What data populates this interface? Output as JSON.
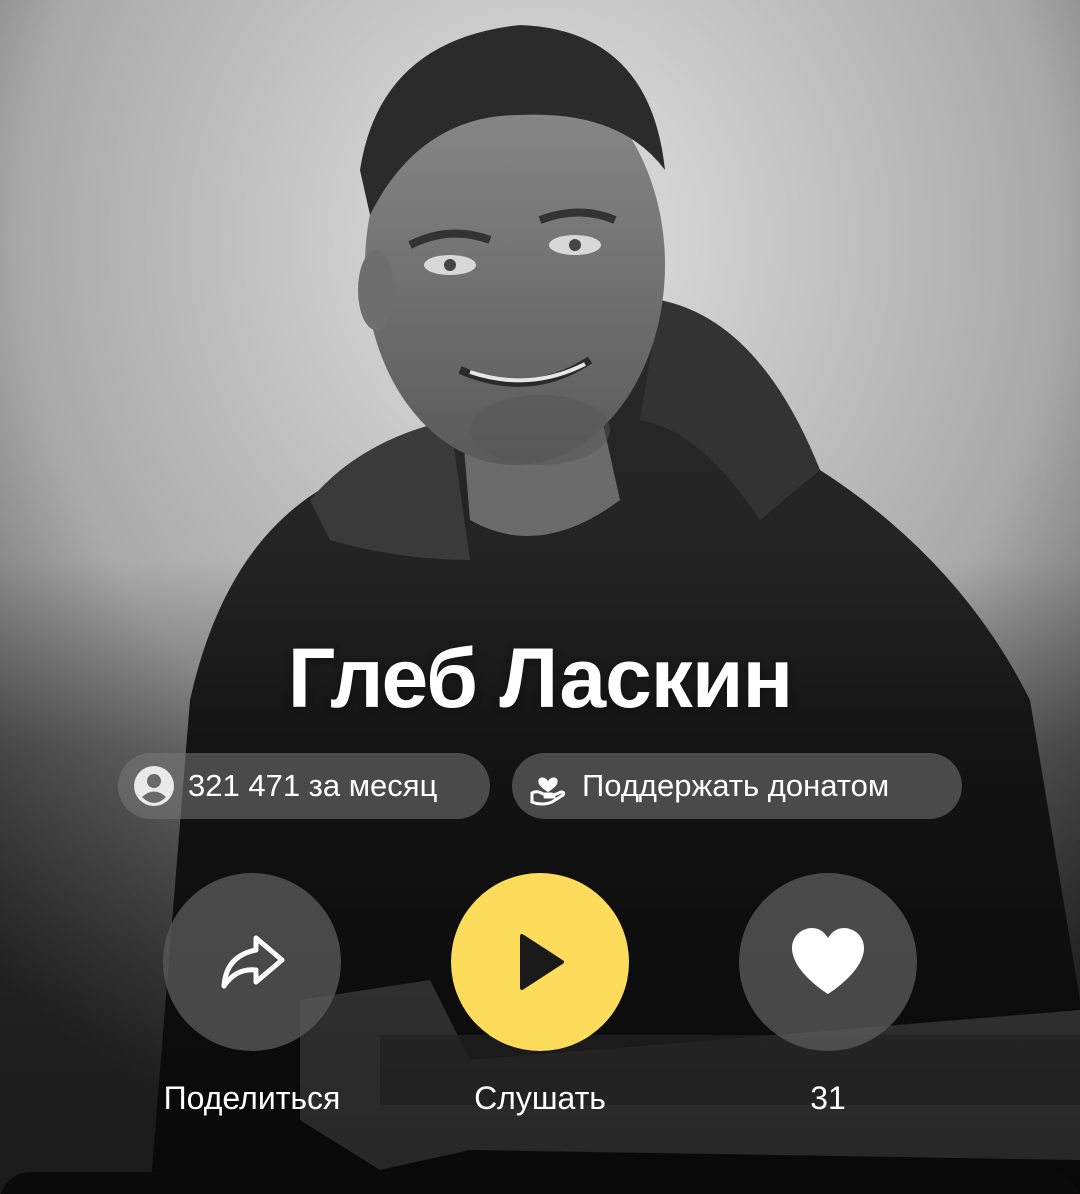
{
  "artist": {
    "name": "Глеб Ласкин"
  },
  "stats": {
    "listeners_label": "321 471 за месяц",
    "listeners_icon": "user-icon",
    "donate_label": "Поддержать донатом",
    "donate_icon": "donate-hand-heart-icon"
  },
  "actions": {
    "share": {
      "label": "Поделиться",
      "icon": "share-arrow-icon"
    },
    "play": {
      "label": "Слушать",
      "icon": "play-icon"
    },
    "like": {
      "label": "31",
      "icon": "heart-icon"
    }
  },
  "colors": {
    "accent": "#fddc5c",
    "chip_bg": "#787878",
    "text": "#ffffff"
  }
}
